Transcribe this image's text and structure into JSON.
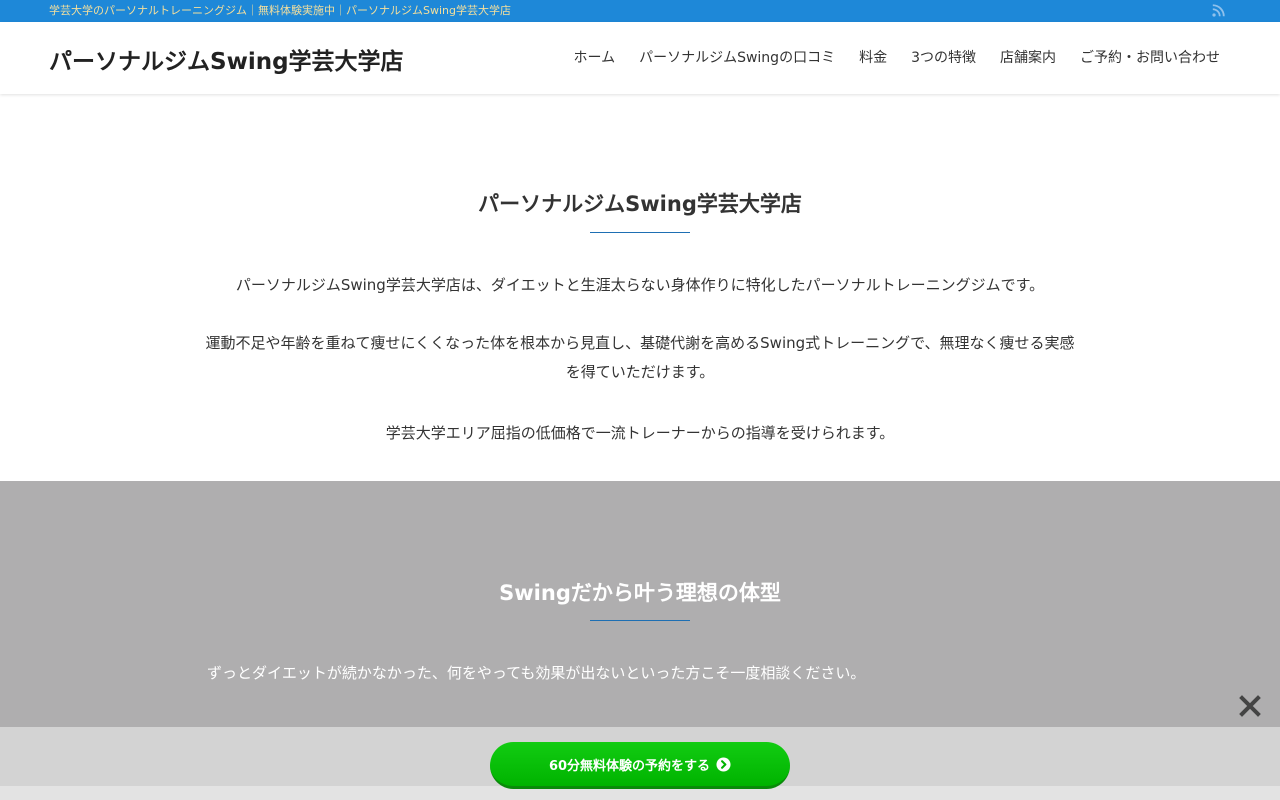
{
  "topbar": {
    "tagline": "学芸大学のパーソナルトレーニングジム｜無料体験実施中｜パーソナルジムSwing学芸大学店",
    "rss_icon": "rss-icon"
  },
  "header": {
    "site_title": "パーソナルジムSwing学芸大学店",
    "nav": [
      {
        "label": "ホーム"
      },
      {
        "label": "パーソナルジムSwingの口コミ"
      },
      {
        "label": "料金"
      },
      {
        "label": "3つの特徴"
      },
      {
        "label": "店舗案内"
      },
      {
        "label": "ご予約・お問い合わせ"
      }
    ]
  },
  "intro": {
    "title": "パーソナルジムSwing学芸大学店",
    "paragraphs": [
      "パーソナルジムSwing学芸大学店は、ダイエットと生涯太らない身体作りに特化したパーソナルトレーニングジムです。",
      "運動不足や年齢を重ねて痩せにくくなった体を根本から見直し、基礎代謝を高めるSwing式トレーニングで、無理なく痩せる実感を得ていただけます。",
      "学芸大学エリア屈指の低価格で一流トレーナーからの指導を受けられます。"
    ]
  },
  "feature": {
    "title": "Swingだから叶う理想の体型",
    "text": "ずっとダイエットが続かなかった、何をやっても効果が出ないといった方こそ一度相談ください。"
  },
  "cta": {
    "button_label": "60分無料体験の予約をする",
    "icon": "circle-chevron-right-icon",
    "close_icon": "close-icon"
  },
  "colors": {
    "topbar": "#1e88d8",
    "topbar_text": "#f3df9e",
    "accent_rule": "#1e6fb3",
    "feature_bg": "#afaeaf",
    "cta_green": "#00c000"
  }
}
